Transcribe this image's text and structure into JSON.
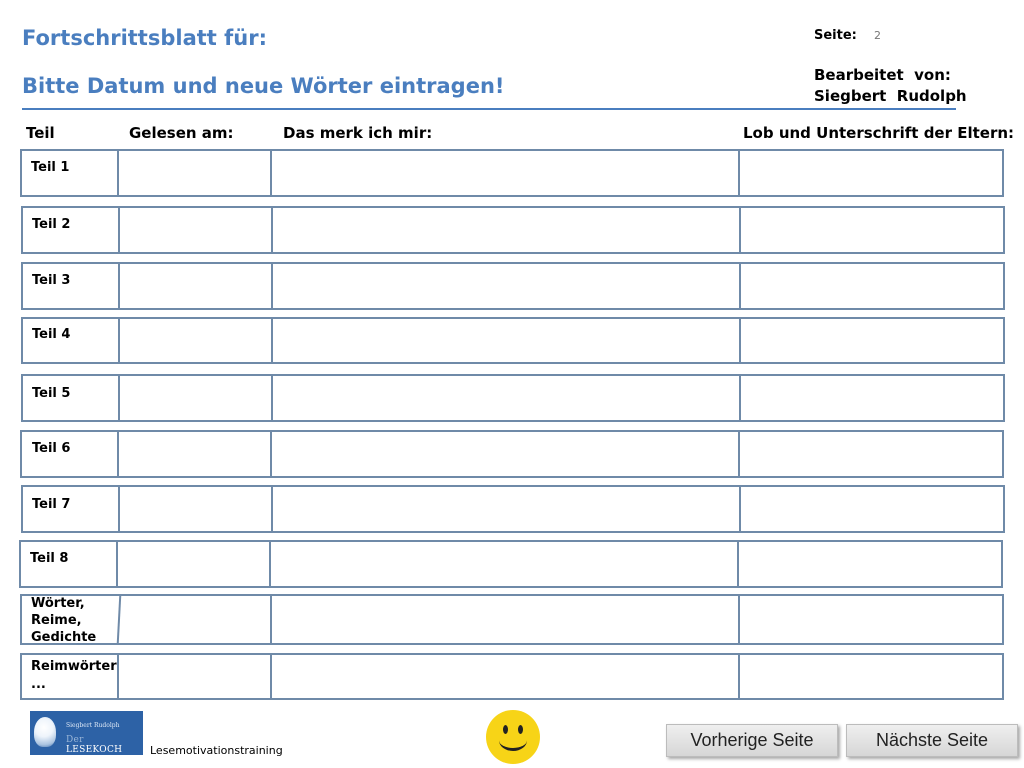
{
  "header": {
    "title": "Fortschrittsblatt für:",
    "subtitle": "Bitte Datum und neue Wörter eintragen!",
    "page_label": "Seite:",
    "page_number": "2",
    "edited_by_label": "Bearbeitet  von:",
    "edited_by_name": "Siegbert  Rudolph"
  },
  "columns": {
    "teil": "Teil",
    "gelesen": "Gelesen am:",
    "merk": "Das merk ich mir:",
    "lob": "Lob und Unterschrift der Eltern:"
  },
  "rows": [
    {
      "label": "Teil 1"
    },
    {
      "label": "Teil 2"
    },
    {
      "label": "Teil 3"
    },
    {
      "label": "Teil 4"
    },
    {
      "label": "Teil 5"
    },
    {
      "label": "Teil 6"
    },
    {
      "label": "Teil 7"
    },
    {
      "label": "Teil 8"
    },
    {
      "label_lines": [
        "Wörter,",
        "Reime,",
        "Gedichte"
      ]
    },
    {
      "label_lines": [
        "Reimwörter",
        "..."
      ]
    }
  ],
  "footer": {
    "logo_small": "Siegbert Rudolph",
    "logo_prefix": "Der",
    "logo_main": "LESEKOCH",
    "text": "Lesemotivationstraining",
    "prev_button": "Vorherige Seite",
    "next_button": "Nächste Seite"
  },
  "colors": {
    "heading": "#4a7ebf",
    "border": "#6f8aa8",
    "smiley": "#f7d417"
  },
  "icons": {
    "smiley": "smiley-icon",
    "logo": "lightbulb-logo"
  }
}
